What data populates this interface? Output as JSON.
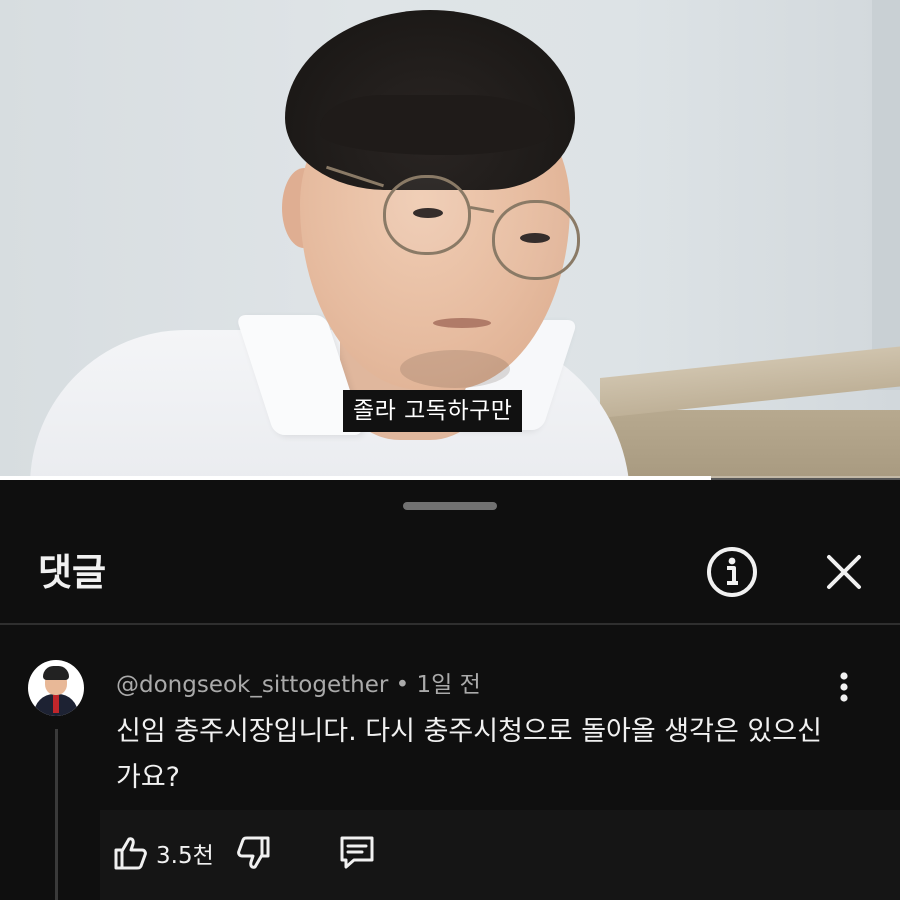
{
  "video": {
    "caption": "졸라 고독하구만",
    "progress_fraction": 0.79
  },
  "comments_panel": {
    "title": "댓글",
    "info_icon": "info-circle-icon",
    "close_icon": "close-icon"
  },
  "comment": {
    "author": "@dongseok_sittogether",
    "separator": "•",
    "time": "1일 전",
    "text": "신임 충주시장입니다. 다시 충주시청으로 돌아올 생각은 있으신가요?",
    "likes": "3.5천",
    "icons": {
      "like": "thumbs-up-icon",
      "dislike": "thumbs-down-icon",
      "reply": "reply-icon",
      "more": "more-vertical-icon"
    }
  },
  "colors": {
    "background": "#0f0f0f",
    "text_primary": "#f1f1f1",
    "text_secondary": "#aaaaaa",
    "divider": "#2f2f2f"
  }
}
